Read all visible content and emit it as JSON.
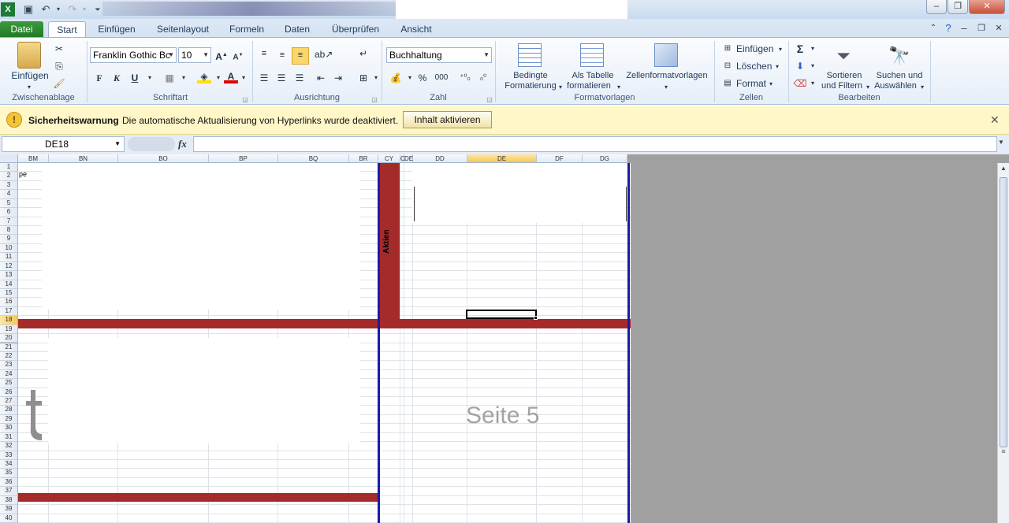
{
  "window": {
    "minimize": "–",
    "restore": "❐",
    "close": "✕"
  },
  "tabs": [
    "Datei",
    "Start",
    "Einfügen",
    "Seitenlayout",
    "Formeln",
    "Daten",
    "Überprüfen",
    "Ansicht"
  ],
  "ribbon": {
    "clipboard": {
      "paste": "Einfügen",
      "label": "Zwischenablage"
    },
    "font": {
      "name": "Franklin Gothic Bc",
      "size": "10",
      "label": "Schriftart",
      "bold": "F",
      "italic": "K",
      "underline": "U"
    },
    "alignment": {
      "label": "Ausrichtung"
    },
    "number": {
      "format": "Buchhaltung",
      "percent": "%",
      "thousands": "000",
      "inc": "⁺⁰₀",
      "dec": "₀⁰",
      "label": "Zahl"
    },
    "styles": {
      "conditional_1": "Bedingte",
      "conditional_2": "Formatierung",
      "table_1": "Als Tabelle",
      "table_2": "formatieren",
      "cell_styles": "Zellenformatvorlagen",
      "label": "Formatvorlagen"
    },
    "cells": {
      "insert": "Einfügen",
      "delete": "Löschen",
      "format": "Format",
      "label": "Zellen"
    },
    "editing": {
      "sort_1": "Sortieren",
      "sort_2": "und Filtern",
      "find_1": "Suchen und",
      "find_2": "Auswählen",
      "label": "Bearbeiten"
    }
  },
  "security_bar": {
    "title": "Sicherheitswarnung",
    "message": "Die automatische Aktualisierung von Hyperlinks wurde deaktiviert.",
    "button": "Inhalt aktivieren"
  },
  "formula_bar": {
    "name_box": "DE18",
    "fx": "fx",
    "value": ""
  },
  "sheet": {
    "columns": [
      "BM",
      "BN",
      "BO",
      "BP",
      "BQ",
      "BR",
      "CY",
      "C",
      "DE",
      "DD",
      "DE",
      "DF",
      "DG"
    ],
    "rows": [
      "1",
      "2",
      "3",
      "4",
      "5",
      "6",
      "7",
      "8",
      "9",
      "10",
      "11",
      "12",
      "13",
      "14",
      "15",
      "16",
      "17",
      "18",
      "19",
      "20",
      "21",
      "22",
      "23",
      "24",
      "25",
      "26",
      "27",
      "28",
      "29",
      "30",
      "31",
      "32",
      "33",
      "34",
      "35",
      "36",
      "37",
      "38",
      "39",
      "40"
    ],
    "selected_row": "18",
    "selected_col": "DE",
    "cell_text_pe": "pe",
    "vertical_label": "Aktien",
    "page_label": "Seite 5"
  }
}
